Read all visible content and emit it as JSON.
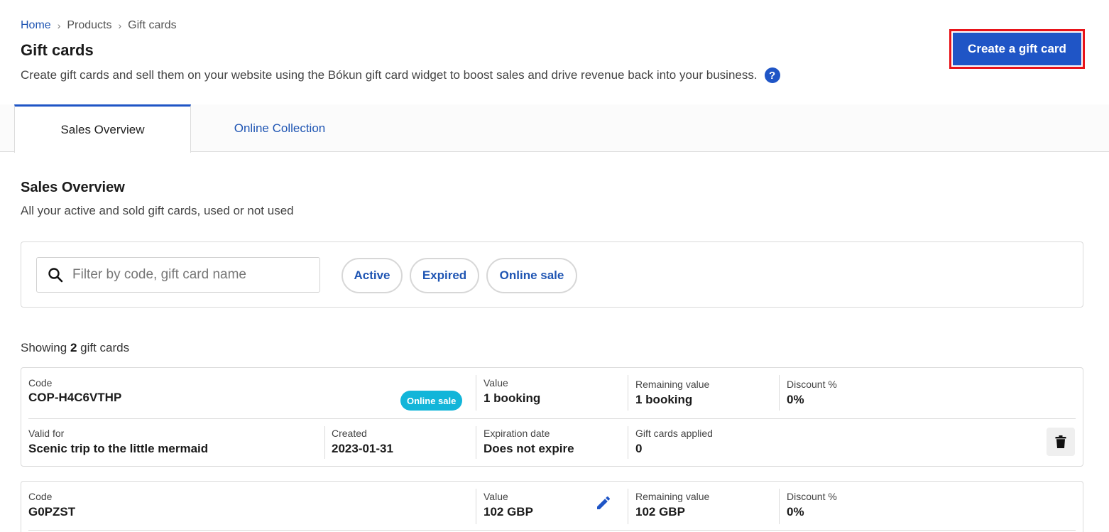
{
  "breadcrumb": {
    "home": "Home",
    "products": "Products",
    "current": "Gift cards",
    "separator": "›"
  },
  "header": {
    "title": "Gift cards",
    "description": "Create gift cards and sell them on your website using the Bókun gift card widget to boost sales and drive revenue back into your business.",
    "help_icon": "?",
    "create_button": "Create a gift card"
  },
  "tabs": {
    "sales": "Sales Overview",
    "online": "Online Collection"
  },
  "section": {
    "title": "Sales Overview",
    "subtitle": "All your active and sold gift cards, used or not used"
  },
  "filters": {
    "search_placeholder": "Filter by code, gift card name",
    "chips": {
      "active": "Active",
      "expired": "Expired",
      "online": "Online sale"
    }
  },
  "showing": {
    "prefix": "Showing",
    "count": "2",
    "suffix": "gift cards"
  },
  "cards": [
    {
      "code_label": "Code",
      "code": "COP-H4C6VTHP",
      "badge": "Online sale",
      "value_label": "Value",
      "value": "1 booking",
      "remaining_label": "Remaining value",
      "remaining": "1 booking",
      "discount_label": "Discount %",
      "discount": "0%",
      "valid_label": "Valid for",
      "valid": "Scenic trip to the little mermaid",
      "created_label": "Created",
      "created": "2023-01-31",
      "expiration_label": "Expiration date",
      "expiration": "Does not expire",
      "applied_label": "Gift cards applied",
      "applied": "0"
    },
    {
      "code_label": "Code",
      "code": "G0PZST",
      "value_label": "Value",
      "value": "102 GBP",
      "remaining_label": "Remaining value",
      "remaining": "102 GBP",
      "discount_label": "Discount %",
      "discount": "0%"
    }
  ],
  "colors": {
    "primary": "#1f55c6",
    "link": "#1f55b3",
    "badge": "#12b5d9",
    "highlight": "#e8141a"
  },
  "icons": {
    "help": "help-icon",
    "search": "search-icon",
    "trash": "trash-icon",
    "edit": "edit-icon"
  }
}
